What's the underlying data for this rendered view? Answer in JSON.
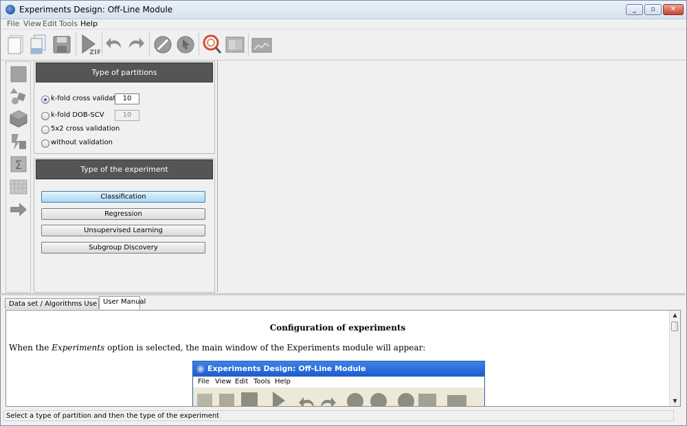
{
  "window": {
    "title": "Experiments Design: Off-Line Module"
  },
  "menubar": {
    "items": [
      "File",
      "View",
      "Edit",
      "Tools",
      "Help"
    ]
  },
  "toolbar": {
    "icons": [
      "new-document-icon",
      "open-documents-icon",
      "save-icon",
      "run-zip-icon",
      "undo-icon",
      "redo-icon",
      "stop-icon",
      "pointer-icon",
      "zoom-help-icon",
      "preview-icon",
      "graph-icon"
    ],
    "zip_label": "ZIP"
  },
  "sidebar": {
    "icons": [
      "dataset-icon",
      "preprocess-icon",
      "methods-icon",
      "postprocess-icon",
      "statistics-icon",
      "visualization-icon",
      "connection-arrow-icon"
    ],
    "sigma": "Σ"
  },
  "partitions": {
    "header": "Type of partitions",
    "options": [
      {
        "label": "k-fold cross validation",
        "value": "10",
        "checked": true
      },
      {
        "label": "k-fold DOB-SCV",
        "value": "10",
        "checked": false
      },
      {
        "label": "5x2 cross validation",
        "checked": false
      },
      {
        "label": "without validation",
        "checked": false
      }
    ]
  },
  "experiment": {
    "header": "Type of the experiment",
    "buttons": [
      "Classification",
      "Regression",
      "Unsupervised Learning",
      "Subgroup Discovery"
    ],
    "selected": "Classification"
  },
  "tabs": [
    "Data set / Algorithms Use Case",
    "User Manual"
  ],
  "active_tab": "User Manual",
  "manual": {
    "title": "Configuration of experiments",
    "para_pre": "When the ",
    "para_em": "Experiments",
    "para_post": " option is selected, the main window of the Experiments module will appear:",
    "screenshot": {
      "title": "Experiments Design: Off-Line Module",
      "menu": [
        "File",
        "View",
        "Edit",
        "Tools",
        "Help"
      ]
    }
  },
  "status": "Select a type of partition and then the type of the experiment",
  "colors": {
    "header_bg": "#555555",
    "selected_button": "#a9d6f3",
    "titlebar": "#d6e2f0"
  }
}
